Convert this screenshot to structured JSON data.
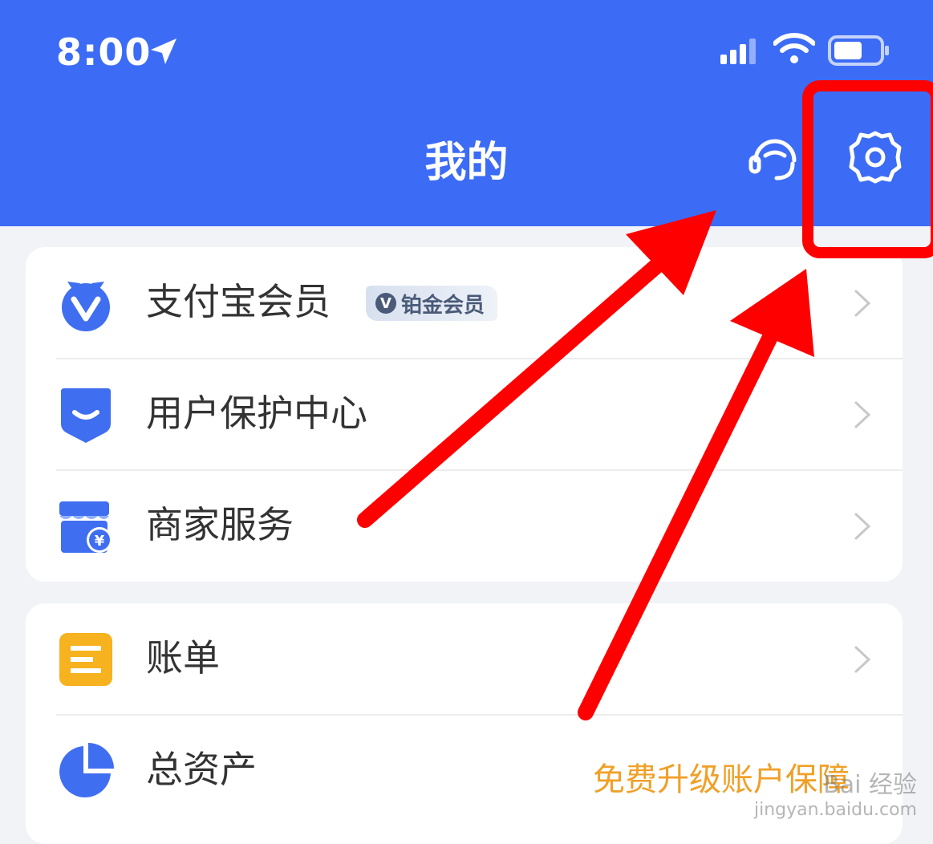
{
  "status_bar": {
    "time": "8:00"
  },
  "header": {
    "title": "我的"
  },
  "card1": {
    "items": [
      {
        "label": "支付宝会员",
        "badge": "铂金会员",
        "badge_icon": "V"
      },
      {
        "label": "用户保护中心"
      },
      {
        "label": "商家服务",
        "icon_symbol": "¥"
      }
    ]
  },
  "card2": {
    "items": [
      {
        "label": "账单"
      },
      {
        "label": "总资产",
        "promo": "免费升级账户保障"
      }
    ]
  },
  "watermark": {
    "line1": "Bai 经验",
    "line2": "jingyan.baidu.com"
  },
  "colors": {
    "header": "#3c6cf5",
    "accent_blue": "#3f6ef0",
    "bill_yellow": "#f6b21f",
    "promo_orange": "#f0a028",
    "annotation_red": "#ff0000"
  }
}
